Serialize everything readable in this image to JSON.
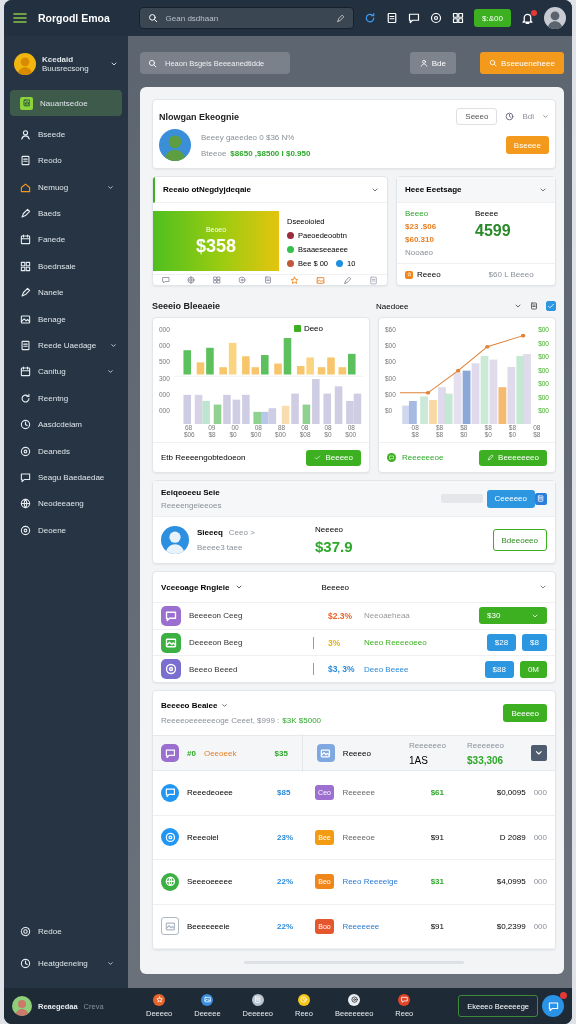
{
  "topbar": {
    "title": "Rorgodl Emoa",
    "search": {
      "placeholder": "Gean dsdhaan"
    },
    "button": "$:&00"
  },
  "sidebar": {
    "profile": {
      "name": "Kcedaid",
      "subtitle": "Buusrecsong"
    },
    "items": [
      {
        "label": "Nauantsedoe",
        "selected": true,
        "expandable": false
      },
      {
        "label": "Bseede",
        "selected": false,
        "expandable": false
      },
      {
        "label": "Reodo",
        "selected": false,
        "expandable": false
      },
      {
        "label": "Nemuog",
        "selected": false,
        "expandable": true
      },
      {
        "label": "Baeds",
        "selected": false,
        "expandable": false
      },
      {
        "label": "Fanede",
        "selected": false,
        "expandable": false
      },
      {
        "label": "Boednsaie",
        "selected": false,
        "expandable": false
      },
      {
        "label": "Nanele",
        "selected": false,
        "expandable": false
      },
      {
        "label": "Benage",
        "selected": false,
        "expandable": false
      },
      {
        "label": "Reede Uaedage",
        "selected": false,
        "expandable": true
      },
      {
        "label": "Canitug",
        "selected": false,
        "expandable": true
      },
      {
        "label": "Reentng",
        "selected": false,
        "expandable": false
      },
      {
        "label": "Aasdcdeiam",
        "selected": false,
        "expandable": false
      },
      {
        "label": "Deaneds",
        "selected": false,
        "expandable": false
      },
      {
        "label": "Seagu Baedaedae",
        "selected": false,
        "expandable": false
      },
      {
        "label": "Neodeeaeng",
        "selected": false,
        "expandable": false
      },
      {
        "label": "Deoene",
        "selected": false,
        "expandable": false
      }
    ],
    "bottom_items": [
      {
        "label": "Redoe",
        "selected": false,
        "expandable": false
      },
      {
        "label": "Heatgdeneing",
        "selected": false,
        "expandable": true
      }
    ]
  },
  "toolbar": {
    "search": {
      "placeholder": "Heaon Bsgeis Beeeanedtidde"
    },
    "user_button": "Bde",
    "action_button": "Bseeueneheee"
  },
  "profile_card": {
    "title": "Nlowgan Ekeognie",
    "filter_button": "Seeeo",
    "menu_label": "Bdi",
    "line": "Beeey gaeedeo 0 $36 N%",
    "amount_label": "Bteeoe",
    "amounts": "$8650 ,$8500 I $0.950",
    "button": "Bseeee"
  },
  "stats_card": {
    "title": "Reeaio otNegdyjdeqaie",
    "tile_label": "Beoeo",
    "tile_value": "$358",
    "legend_title": "Dseeoioied",
    "legend": [
      {
        "label": "Paeoedeoobtn",
        "color": "#9b2d3b"
      },
      {
        "label": "Bsaaeseeaeee",
        "color": "#34c04c"
      },
      {
        "label": "Bee $ 00",
        "color": "#c0583a"
      },
      {
        "label": "10",
        "color": "#1e90e0"
      }
    ]
  },
  "summary_card": {
    "title": "Heee Eeetsage",
    "left_label": "Beeeo",
    "left_values": [
      "$23 .$06",
      "$60.310"
    ],
    "left_note": "Nooaeo",
    "right_label": "Beeee",
    "right_value": "4599",
    "footer_label": "Reeeo",
    "footer_value": "$60 L Beeeo"
  },
  "charts_section": {
    "title": "Seeeio Bleeaeie",
    "filter": "Naedoee",
    "checked": true,
    "bar_chart": {
      "legend": "Deeo",
      "y_labels": [
        "000",
        "000",
        "500",
        "300",
        "000",
        "000"
      ],
      "x_labels": [
        "68",
        "09",
        "00",
        "08",
        "88",
        "08",
        "08",
        "08"
      ],
      "x_sublabels": [
        "$06",
        "$8",
        "$0",
        "$00",
        "$00",
        "$08",
        "$0",
        "$00"
      ],
      "footer": "Etb Reeeengobtedoeon",
      "button": "Beeeeo"
    },
    "combo_chart": {
      "y_labels": [
        "$60",
        "$00",
        "$00",
        "$00",
        "$00",
        "$0"
      ],
      "y2_labels": [
        "$00",
        "$00",
        "$00",
        "$00",
        "$00",
        "$00",
        "$00"
      ],
      "x_labels": [
        "08",
        "$8",
        "$8",
        "$8",
        "$8",
        "08"
      ],
      "x_sublabels": [
        "$8",
        "$8",
        "$0",
        "$0",
        "$0",
        "$8"
      ],
      "footer": "Reeeeeeoe",
      "button": "Beeeeeeeo"
    }
  },
  "account_card": {
    "title": "Eeiqeoeeu Seie",
    "subtitle": "Reeeengeieeoes",
    "button": "Ceeeeeo",
    "name": "Sieeeq",
    "name_note": "Ceeo >",
    "detail": "Beeee3 taee",
    "amount_label": "Neeeeo",
    "amount": "$37.9",
    "action": "Bdeeoeeo"
  },
  "products": {
    "title": "Vceeoage Rngieie",
    "column": "Beeeeo",
    "rows": [
      {
        "name": "Beeeeon Ceeg",
        "color": "#9b6fd0",
        "kind": "warning",
        "percent": "$2.3%",
        "note": "Neeoaeheaa",
        "actions": [
          {
            "label": "$30",
            "kind": "success",
            "dropdown": true
          }
        ]
      },
      {
        "name": "Deeeeon Beeg",
        "color": "#3cb043",
        "kind": "success",
        "percent": "3%",
        "note": "Neeo Reeeeoeeo",
        "actions": [
          {
            "label": "$28",
            "kind": "info",
            "dropdown": false
          },
          {
            "label": "$8",
            "kind": "info",
            "dropdown": false
          }
        ]
      },
      {
        "name": "Beeeo Beeed",
        "color": "#7a6fd0",
        "kind": "info",
        "percent": "$3, 3%",
        "note": "Deeo Beeee",
        "actions": [
          {
            "label": "$88",
            "kind": "info",
            "dropdown": false
          },
          {
            "label": "0M",
            "kind": "success",
            "dropdown": false
          }
        ]
      }
    ]
  },
  "table": {
    "title": "Beeeeo Beaiee",
    "subtitle": "Reeeeoeeeeeeoge Ceeet, $999 :",
    "subtitle_highlight": "$3K $5000",
    "button": "Beeeeo",
    "header": {
      "tag": "#0",
      "name": "Oeeoeek",
      "value": "$35",
      "label": "Reeeeo",
      "col_1": "Reeeeeeo",
      "col_1_value": "1AS",
      "col_2": "Reeeeeeo",
      "col_2_value": "$33,306"
    },
    "rows": [
      {
        "name": "Reeedeoeee",
        "color": "#2196f3",
        "percent": "$85",
        "tag": {
          "label": "Ceo",
          "color": "#9c6fd0"
        },
        "desc": "Reeeeee",
        "link": false,
        "value": "$61",
        "positive": true,
        "amount": "$0,0095",
        "code": "000"
      },
      {
        "name": "Reeeoiel",
        "color": "#2196f3",
        "percent": "23%",
        "tag": {
          "label": "Bee",
          "color": "#f39c12"
        },
        "desc": "Reeeeoe",
        "link": false,
        "value": "$91",
        "positive": false,
        "amount": "D 2089",
        "code": "000"
      },
      {
        "name": "Seeeoeeeee",
        "color": "#3cb043",
        "percent": "22%",
        "tag": {
          "label": "Beo",
          "color": "#f0861a"
        },
        "desc": "Reeo Reeeeige",
        "link": true,
        "value": "$31",
        "positive": true,
        "amount": "$4,0995",
        "code": "000"
      },
      {
        "name": "Beeeeeeeie",
        "color": "#b0b8c4",
        "percent": "22%",
        "tag": {
          "label": "Boo",
          "color": "#e4572e"
        },
        "desc": "Reeeeeee",
        "link": true,
        "value": "$91",
        "positive": false,
        "amount": "$0,2399",
        "code": "000"
      }
    ]
  },
  "bottombar": {
    "user": {
      "name": "Reaegedaa",
      "status": "Creva"
    },
    "dock": [
      {
        "label": "Deeeeo",
        "color": "#e8642a"
      },
      {
        "label": "Deeeee",
        "color": "#3a8ee0"
      },
      {
        "label": "Deeeeeo",
        "color": "#b8c4d0"
      },
      {
        "label": "Reeo",
        "color": "#f5c518"
      },
      {
        "label": "Beeeeeeeo",
        "color": "#e8eef4"
      },
      {
        "label": "Reeo",
        "color": "#e0452a"
      }
    ],
    "button": "Ekeeeo Beeeeege",
    "chat_badge": true
  }
}
